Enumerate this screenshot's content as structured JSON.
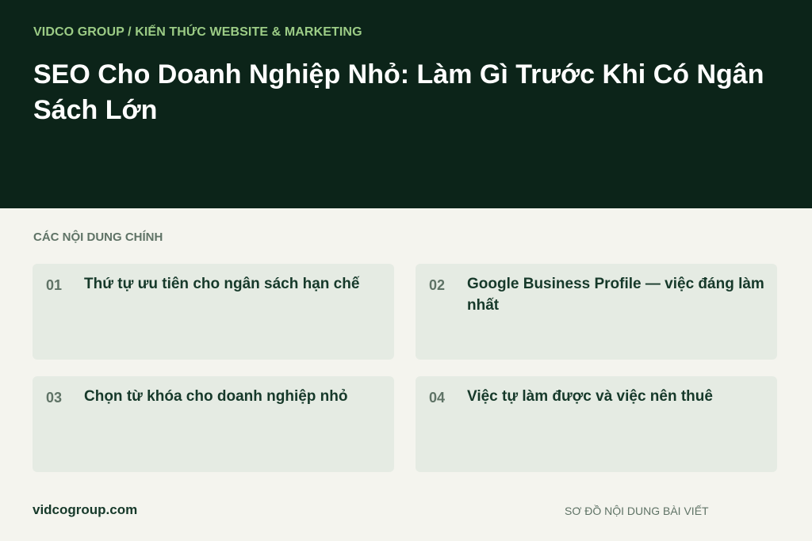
{
  "header": {
    "breadcrumb": "VIDCO GROUP / KIẾN THỨC WEBSITE & MARKETING",
    "title": "SEO Cho Doanh Nghiệp Nhỏ: Làm Gì Trước Khi Có Ngân Sách Lớn"
  },
  "contents": {
    "label": "CÁC NỘI DUNG CHÍNH",
    "items": [
      {
        "number": "01",
        "text": "Thứ tự ưu tiên cho ngân sách hạn chế"
      },
      {
        "number": "02",
        "text": "Google Business Profile — việc đáng làm nhất"
      },
      {
        "number": "03",
        "text": "Chọn từ khóa cho doanh nghiệp nhỏ"
      },
      {
        "number": "04",
        "text": "Việc tự làm được và việc nên thuê"
      }
    ]
  },
  "footer": {
    "site": "vidcogroup.com",
    "caption": "SƠ ĐỒ NỘI DUNG BÀI VIẾT"
  },
  "colors": {
    "hero_background": "#0c2419",
    "breadcrumb": "#9ccc86",
    "page_background": "#f4f4ee",
    "card_background": "#e5ebe3",
    "card_text": "#16392a",
    "muted": "#5f7366"
  }
}
